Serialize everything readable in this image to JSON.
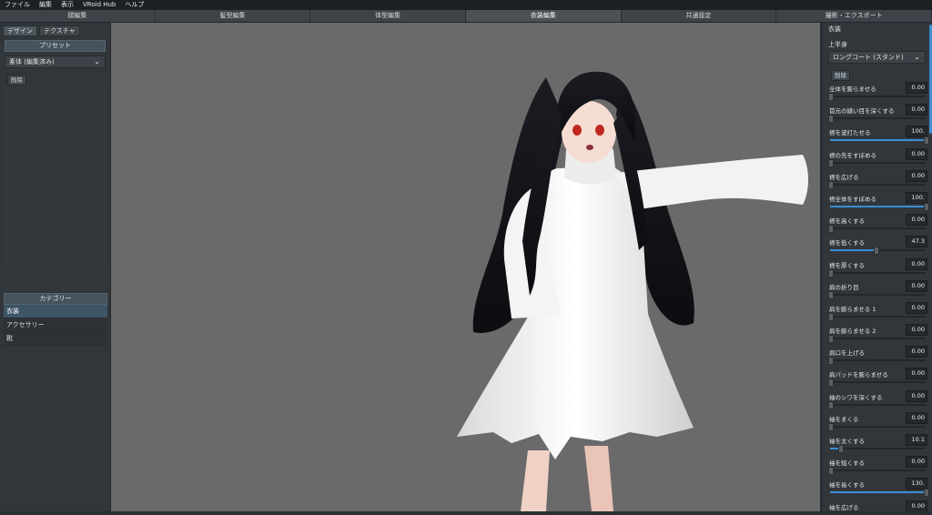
{
  "menubar": [
    "ファイル",
    "編集",
    "表示",
    "VRoid Hub",
    "ヘルプ"
  ],
  "tabs": [
    {
      "label": "顔編集",
      "active": false
    },
    {
      "label": "髪型編集",
      "active": false
    },
    {
      "label": "体型編集",
      "active": false
    },
    {
      "label": "衣装編集",
      "active": true
    },
    {
      "label": "共通設定",
      "active": false
    },
    {
      "label": "撮影・エクスポート",
      "active": false
    }
  ],
  "left": {
    "subtabs": [
      "デザイン",
      "テクスチャ"
    ],
    "preset_header": "プリセット",
    "preset_selected": "素体 (編集済み)",
    "delete_label": "削除",
    "category_header": "カテゴリー",
    "categories": [
      "衣装",
      "アクセサリー",
      "靴"
    ]
  },
  "right": {
    "title": "衣装",
    "group": "上半身",
    "item_selected": "ロングコート (スタンド)",
    "delete_label": "削除",
    "params": [
      {
        "label": "全体を膨らませる",
        "value": "0.00",
        "level": 0
      },
      {
        "label": "首元の縫い目を深くする",
        "value": "0.00",
        "level": 0
      },
      {
        "label": "襟を波打たせる",
        "value": "100.",
        "level": 100
      },
      {
        "label": "襟の先をすぼめる",
        "value": "0.00",
        "level": 0
      },
      {
        "label": "襟を広げる",
        "value": "0.00",
        "level": 0
      },
      {
        "label": "襟全体をすぼめる",
        "value": "100.",
        "level": 100
      },
      {
        "label": "襟を高くする",
        "value": "0.00",
        "level": 0
      },
      {
        "label": "襟を低くする",
        "value": "47.3",
        "level": 47.3
      },
      {
        "label": "襟を厚くする",
        "value": "0.00",
        "level": 0
      },
      {
        "label": "肩の折り目",
        "value": "0.00",
        "level": 0
      },
      {
        "label": "肩を膨らませる 1",
        "value": "0.00",
        "level": 0
      },
      {
        "label": "肩を膨らませる 2",
        "value": "0.00",
        "level": 0
      },
      {
        "label": "肩口を上げる",
        "value": "0.00",
        "level": 0
      },
      {
        "label": "肩パッドを膨らませる",
        "value": "0.00",
        "level": 0
      },
      {
        "label": "袖のシワを深くする",
        "value": "0.00",
        "level": 0
      },
      {
        "label": "袖をまくる",
        "value": "0.00",
        "level": 0
      },
      {
        "label": "袖を太くする",
        "value": "10.1",
        "level": 10.1
      },
      {
        "label": "袖を短くする",
        "value": "0.00",
        "level": 0
      },
      {
        "label": "袖を長くする",
        "value": "130.",
        "level": 100
      },
      {
        "label": "袖を広げる",
        "value": "0.00",
        "level": 0
      }
    ]
  },
  "colors": {
    "accent": "#3b8fd4",
    "viewport_bg": "#6a6a6a",
    "panel_bg": "#31363a"
  }
}
